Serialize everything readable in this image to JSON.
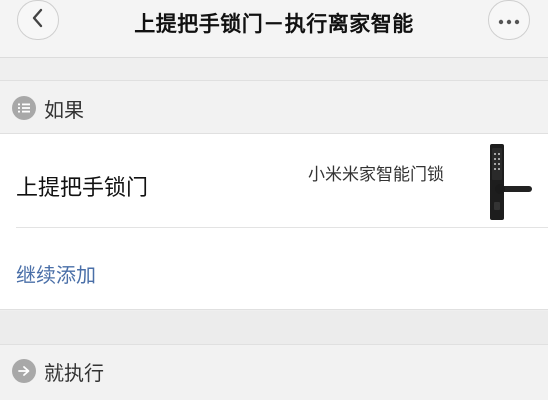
{
  "header": {
    "title": "上提把手锁门－执行离家智能",
    "back_icon": "chevron-left-icon",
    "more_icon": "more-horizontal-icon"
  },
  "if_section": {
    "label": "如果",
    "icon": "list-icon"
  },
  "condition": {
    "label": "上提把手锁门",
    "device_name": "小米米家智能门锁",
    "device_image": "smart-lock-image"
  },
  "add_more_label": "继续添加",
  "then_section": {
    "label": "就执行",
    "icon": "arrow-right-icon"
  },
  "colors": {
    "link": "#4a6fa8",
    "section_icon_bg": "#a8a8a8",
    "background": "#efefef"
  }
}
